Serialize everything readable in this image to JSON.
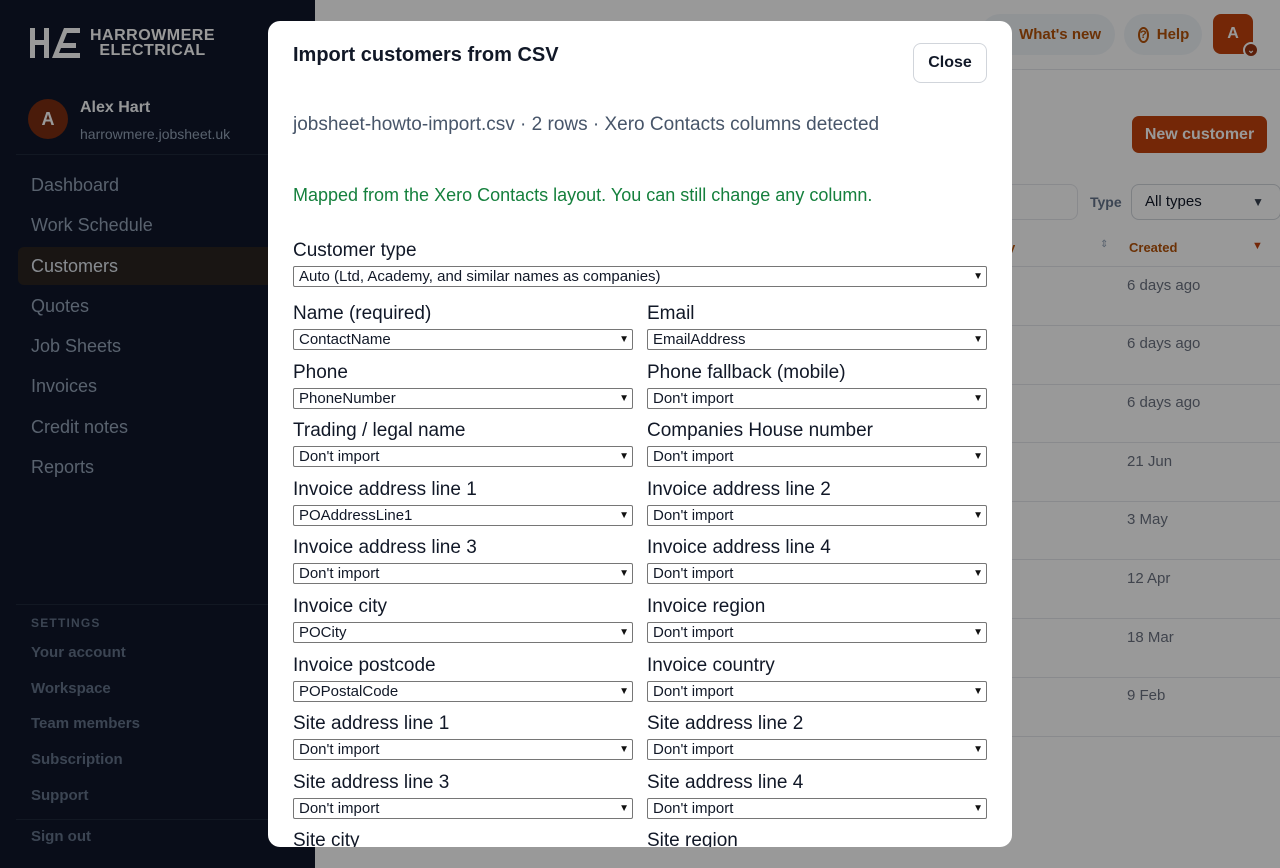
{
  "brand": {
    "line1": "HARROWMERE",
    "line2": "ELECTRICAL"
  },
  "user": {
    "initial": "A",
    "name": "Alex Hart",
    "domain": "harrowmere.jobsheet.uk"
  },
  "nav": [
    "Dashboard",
    "Work Schedule",
    "Customers",
    "Quotes",
    "Job Sheets",
    "Invoices",
    "Credit notes",
    "Reports"
  ],
  "settings": {
    "title": "SETTINGS",
    "items": [
      "Your account",
      "Workspace",
      "Team members",
      "Subscription",
      "Support"
    ],
    "signout": "Sign out"
  },
  "topbar": {
    "whats_new": "What's new",
    "help": "Help",
    "avatar": "A"
  },
  "page": {
    "new_customer": "New customer",
    "type_label": "Type",
    "type_value": "All types",
    "col_company_partial": "ny",
    "col_created": "Created",
    "dates": [
      "6 days ago",
      "6 days ago",
      "6 days ago",
      "21 Jun",
      "3 May",
      "12 Apr",
      "18 Mar",
      "9 Feb"
    ]
  },
  "modal": {
    "title": "Import customers from CSV",
    "close": "Close",
    "file_info": "jobsheet-howto-import.csv · 2 rows · Xero Contacts columns detected",
    "mapped_msg": "Mapped from the Xero Contacts layout. You can still change any column.",
    "customer_type": {
      "label": "Customer type",
      "value": "Auto (Ltd, Academy, and similar names as companies)"
    },
    "fields": [
      {
        "label": "Name (required)",
        "value": "ContactName"
      },
      {
        "label": "Email",
        "value": "EmailAddress"
      },
      {
        "label": "Phone",
        "value": "PhoneNumber"
      },
      {
        "label": "Phone fallback (mobile)",
        "value": "Don't import"
      },
      {
        "label": "Trading / legal name",
        "value": "Don't import"
      },
      {
        "label": "Companies House number",
        "value": "Don't import"
      },
      {
        "label": "Invoice address line 1",
        "value": "POAddressLine1"
      },
      {
        "label": "Invoice address line 2",
        "value": "Don't import"
      },
      {
        "label": "Invoice address line 3",
        "value": "Don't import"
      },
      {
        "label": "Invoice address line 4",
        "value": "Don't import"
      },
      {
        "label": "Invoice city",
        "value": "POCity"
      },
      {
        "label": "Invoice region",
        "value": "Don't import"
      },
      {
        "label": "Invoice postcode",
        "value": "POPostalCode"
      },
      {
        "label": "Invoice country",
        "value": "Don't import"
      },
      {
        "label": "Site address line 1",
        "value": "Don't import"
      },
      {
        "label": "Site address line 2",
        "value": "Don't import"
      },
      {
        "label": "Site address line 3",
        "value": "Don't import"
      },
      {
        "label": "Site address line 4",
        "value": "Don't import"
      },
      {
        "label": "Site city",
        "value": ""
      },
      {
        "label": "Site region",
        "value": ""
      }
    ]
  }
}
